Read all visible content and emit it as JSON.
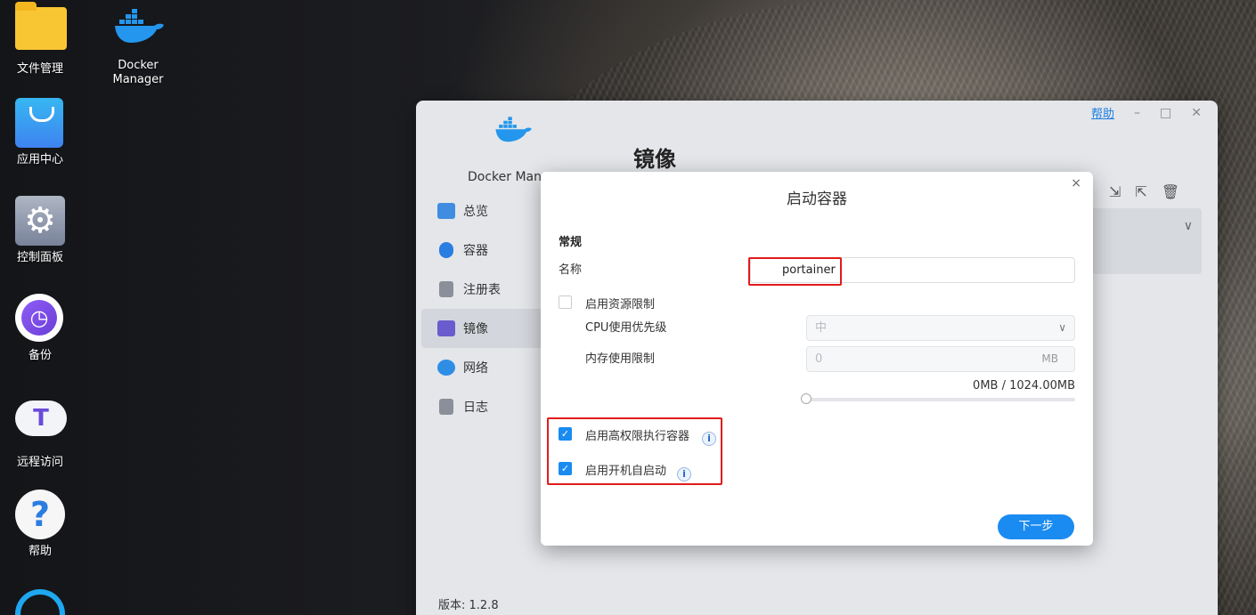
{
  "desktop": {
    "icons": [
      {
        "label": "文件管理"
      },
      {
        "label": "Docker\nManager"
      },
      {
        "label": "应用中心"
      },
      {
        "label": "控制面板"
      },
      {
        "label": "备份"
      },
      {
        "label": "远程访问"
      },
      {
        "label": "帮助"
      }
    ],
    "help_glyph": "?",
    "remote_glyph": "T"
  },
  "window": {
    "app_name": "Docker Mana",
    "page_title": "镜像",
    "help_link": "帮助",
    "controls": {
      "minimize": "–",
      "maximize": "□",
      "close": "✕"
    },
    "nav": [
      {
        "label": "总览",
        "icon": "dashboard-icon",
        "color": "#3e8de0"
      },
      {
        "label": "容器",
        "icon": "container-icon",
        "color": "#2a7de1"
      },
      {
        "label": "注册表",
        "icon": "registry-icon",
        "color": "#8a8f99"
      },
      {
        "label": "镜像",
        "icon": "image-icon",
        "color": "#6a5ccf"
      },
      {
        "label": "网络",
        "icon": "network-icon",
        "color": "#2e8ee6"
      },
      {
        "label": "日志",
        "icon": "log-icon",
        "color": "#8a8f99"
      }
    ],
    "version": "版本: 1.2.8",
    "toolbar": {
      "import_icon": "import-icon",
      "export_icon": "export-icon",
      "delete_icon": "delete-icon"
    }
  },
  "modal": {
    "title": "启动容器",
    "close": "×",
    "section": "常规",
    "name_label": "名称",
    "name_value": "portainer",
    "resource_limit_label": "启用资源限制",
    "resource_limit_checked": false,
    "cpu_label": "CPU使用优先级",
    "cpu_value": "中",
    "mem_label": "内存使用限制",
    "mem_value": "0",
    "mem_unit": "MB",
    "mem_readout": "0MB / 1024.00MB",
    "mem_slider_fraction": 0,
    "privileged_label": "启用高权限执行容器",
    "privileged_checked": true,
    "autostart_label": "启用开机自启动",
    "autostart_checked": true,
    "info_glyph": "i",
    "check_glyph": "✓",
    "next_label": "下一步"
  },
  "colors": {
    "accent": "#1a8bf0",
    "highlight": "#e11b1b"
  }
}
